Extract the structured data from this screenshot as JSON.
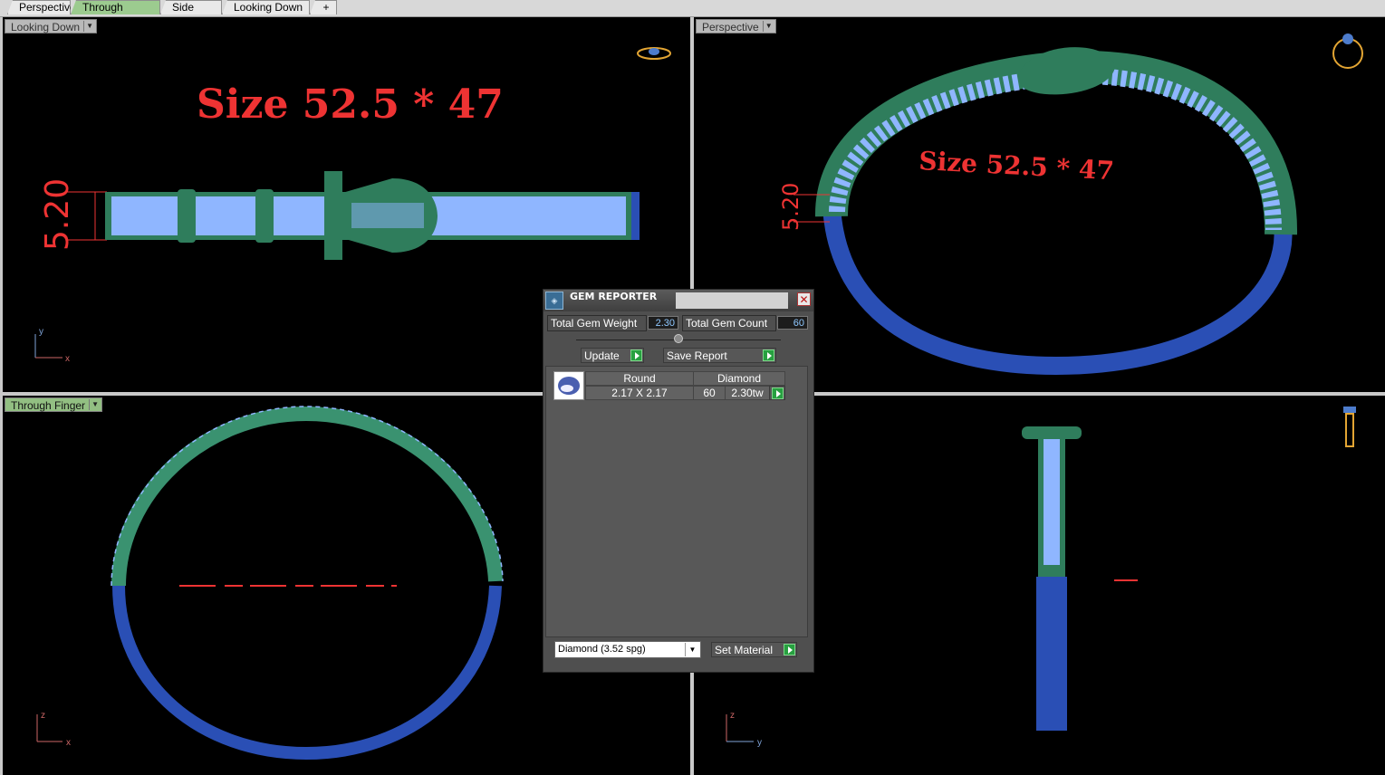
{
  "tabs": [
    "Perspective",
    "Through Finger",
    "Side View",
    "Looking Down"
  ],
  "add_tab_symbol": "+",
  "viewports": {
    "top_left": {
      "label": "Looking Down",
      "annotation": "Size 52.5 * 47",
      "dimension": "5.20",
      "axes": {
        "v": "y",
        "h": "x"
      }
    },
    "top_right": {
      "label": "Perspective",
      "annotation": "Size 52.5 * 47",
      "dimension": "5.20"
    },
    "bottom_left": {
      "label": "Through Finger",
      "axes": {
        "v": "z",
        "h": "x"
      }
    },
    "bottom_right": {
      "axes": {
        "v": "z",
        "h": "y"
      }
    }
  },
  "gem_reporter": {
    "title": "GEM REPORTER",
    "close_symbol": "✕",
    "total_weight_label": "Total Gem Weight",
    "total_weight_value": "2.30",
    "total_count_label": "Total Gem Count",
    "total_count_value": "60",
    "update_label": "Update",
    "save_report_label": "Save Report",
    "row": {
      "shape": "Round",
      "material": "Diamond",
      "size": "2.17 X 2.17",
      "count": "60",
      "weight": "2.30tw"
    },
    "material_select": "Diamond     (3.52 spg)",
    "set_material_label": "Set Material"
  },
  "colors": {
    "band_green": "#2f7d5c",
    "gem_blue": "#8fb6ff",
    "band_blue": "#2a4fb5",
    "dimension_red": "#e02020",
    "viewport_bg": "#000000"
  }
}
